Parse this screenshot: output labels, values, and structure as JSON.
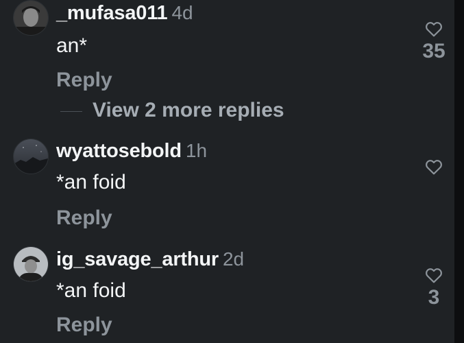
{
  "comments": [
    {
      "username": "_mufasa011",
      "time": "4d",
      "text": "an*",
      "reply_label": "Reply",
      "likes": "35",
      "avatar_icon": "profile-photo-person",
      "view_more": "View 2 more replies"
    },
    {
      "username": "wyattosebold",
      "time": "1h",
      "text": "*an foid",
      "reply_label": "Reply",
      "likes": "",
      "avatar_icon": "profile-photo-night-sky"
    },
    {
      "username": "ig_savage_arthur",
      "time": "2d",
      "text": "*an foid",
      "reply_label": "Reply",
      "likes": "3",
      "avatar_icon": "profile-photo-man-in-cap"
    }
  ],
  "colors": {
    "background": "#1f2225",
    "primary_text": "#f3f5f6",
    "secondary_text": "#8d949b"
  }
}
